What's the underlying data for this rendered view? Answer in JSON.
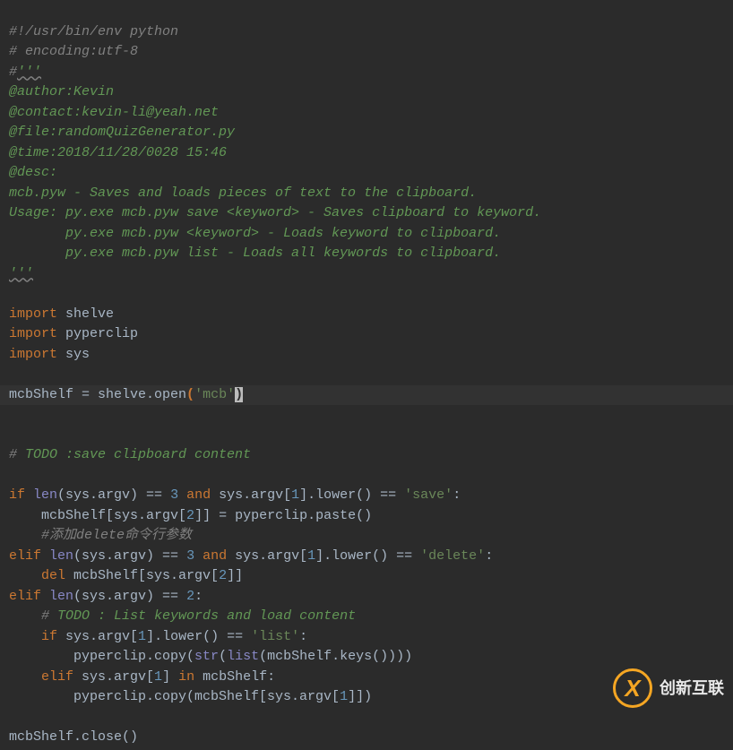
{
  "lines": {
    "l1_a": "#!/usr/bin/env python",
    "l2_a": "# encoding:utf-8",
    "l3_a": "#",
    "l3_b": "'''",
    "l4": "@author:Kevin",
    "l5": "@contact:kevin-li@yeah.net",
    "l6": "@file:randomQuizGenerator.py",
    "l7": "@time:2018/11/28/0028 15:46",
    "l8": "@desc:",
    "l9": "mcb.pyw - Saves and loads pieces of text to the clipboard.",
    "l10": "Usage: py.exe mcb.pyw save <keyword> - Saves clipboard to keyword.",
    "l11": "       py.exe mcb.pyw <keyword> - Loads keyword to clipboard.",
    "l12": "       py.exe mcb.pyw list - Loads all keywords to clipboard.",
    "l13": "'''",
    "l15_kw": "import",
    "l15_m": " shelve",
    "l16_kw": "import",
    "l16_m": " pyperclip",
    "l17_kw": "import",
    "l17_m": " sys",
    "l19_a": "mcbShelf = shelve.open",
    "l19_par1": "(",
    "l19_str": "'mcb'",
    "l19_par2": ")",
    "l21_a": "#",
    "l21_b": " TODO :save clipboard content",
    "l23_if": "if ",
    "l23_len": "len",
    "l23_a": "(sys.argv) == ",
    "l23_n3": "3",
    "l23_sp": " ",
    "l23_and": "and",
    "l23_b": " sys.argv[",
    "l23_n1": "1",
    "l23_c": "].lower() == ",
    "l23_s": "'save'",
    "l23_col": ":",
    "l24_a": "    mcbShelf[sys.argv[",
    "l24_n": "2",
    "l24_b": "]] = pyperclip.paste()",
    "l25_a": "    #添加delete命令行参数",
    "l26_elif": "elif ",
    "l26_len": "len",
    "l26_a": "(sys.argv) == ",
    "l26_n3": "3",
    "l26_sp": " ",
    "l26_and": "and",
    "l26_b": " sys.argv[",
    "l26_n1": "1",
    "l26_c": "].lower() == ",
    "l26_s": "'delete'",
    "l26_col": ":",
    "l27_a": "    ",
    "l27_del": "del",
    "l27_b": " mcbShelf[sys.argv[",
    "l27_n": "2",
    "l27_c": "]]",
    "l28_elif": "elif ",
    "l28_len": "len",
    "l28_a": "(sys.argv) == ",
    "l28_n": "2",
    "l28_col": ":",
    "l29_a": "    ",
    "l29_h": "#",
    "l29_b": " TODO : List keywords and load content",
    "l30_a": "    ",
    "l30_if": "if ",
    "l30_b": "sys.argv[",
    "l30_n": "1",
    "l30_c": "].lower() == ",
    "l30_s": "'list'",
    "l30_col": ":",
    "l31_a": "        pyperclip.copy(",
    "l31_str": "str",
    "l31_p1": "(",
    "l31_list": "list",
    "l31_b": "(mcbShelf.keys())))",
    "l32_a": "    ",
    "l32_elif": "elif ",
    "l32_b": "sys.argv[",
    "l32_n": "1",
    "l32_c": "] ",
    "l32_in": "in",
    "l32_d": " mcbShelf:",
    "l33_a": "        pyperclip.copy(mcbShelf[sys.argv[",
    "l33_n": "1",
    "l33_b": "]])",
    "l35": "mcbShelf.close()"
  },
  "logo_text": "创新互联"
}
